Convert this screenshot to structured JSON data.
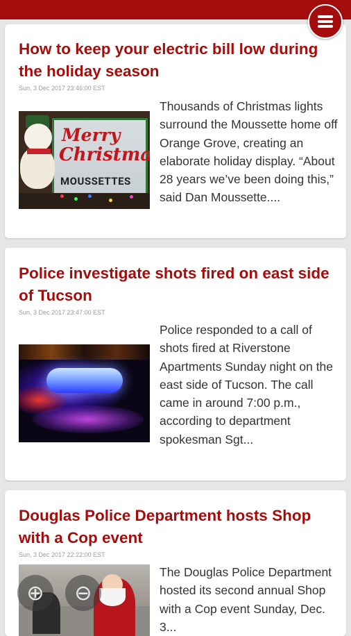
{
  "articles": [
    {
      "title": "How to keep your electric bill low during the holiday season",
      "date": "Sun, 3 Dec 2017 23:46:00 EST",
      "summary": "Thousands of Christmas lights surround the Moussette home off Orange Grove, creating an elaborate holiday display. “About 28 years we’ve been doing this,” said Dan Moussette....",
      "image": {
        "merry": "Merry",
        "christmas": "Christmas",
        "family": "MOUSSETTES"
      }
    },
    {
      "title": "Police investigate shots fired on east side of Tucson",
      "date": "Sun, 3 Dec 2017 23:47:00 EST",
      "summary": "Police responded to a call of shots fired at Riverstone Apartments Sunday night on the east side of Tucson. The call came in around 7:00 p.m., according to department spokesman Sgt..."
    },
    {
      "title": "Douglas Police Department hosts Shop with a Cop event",
      "date": "Sun, 3 Dec 2017 22:22:00 EST",
      "summary": "The Douglas Police Department hosted its second annual Shop with a Cop event Sunday, Dec. 3..."
    }
  ],
  "zoom_controls": {
    "zoom_in_icon": "⊕",
    "zoom_out_icon": "⊖"
  },
  "colors": {
    "brand": "#a50d0d"
  }
}
